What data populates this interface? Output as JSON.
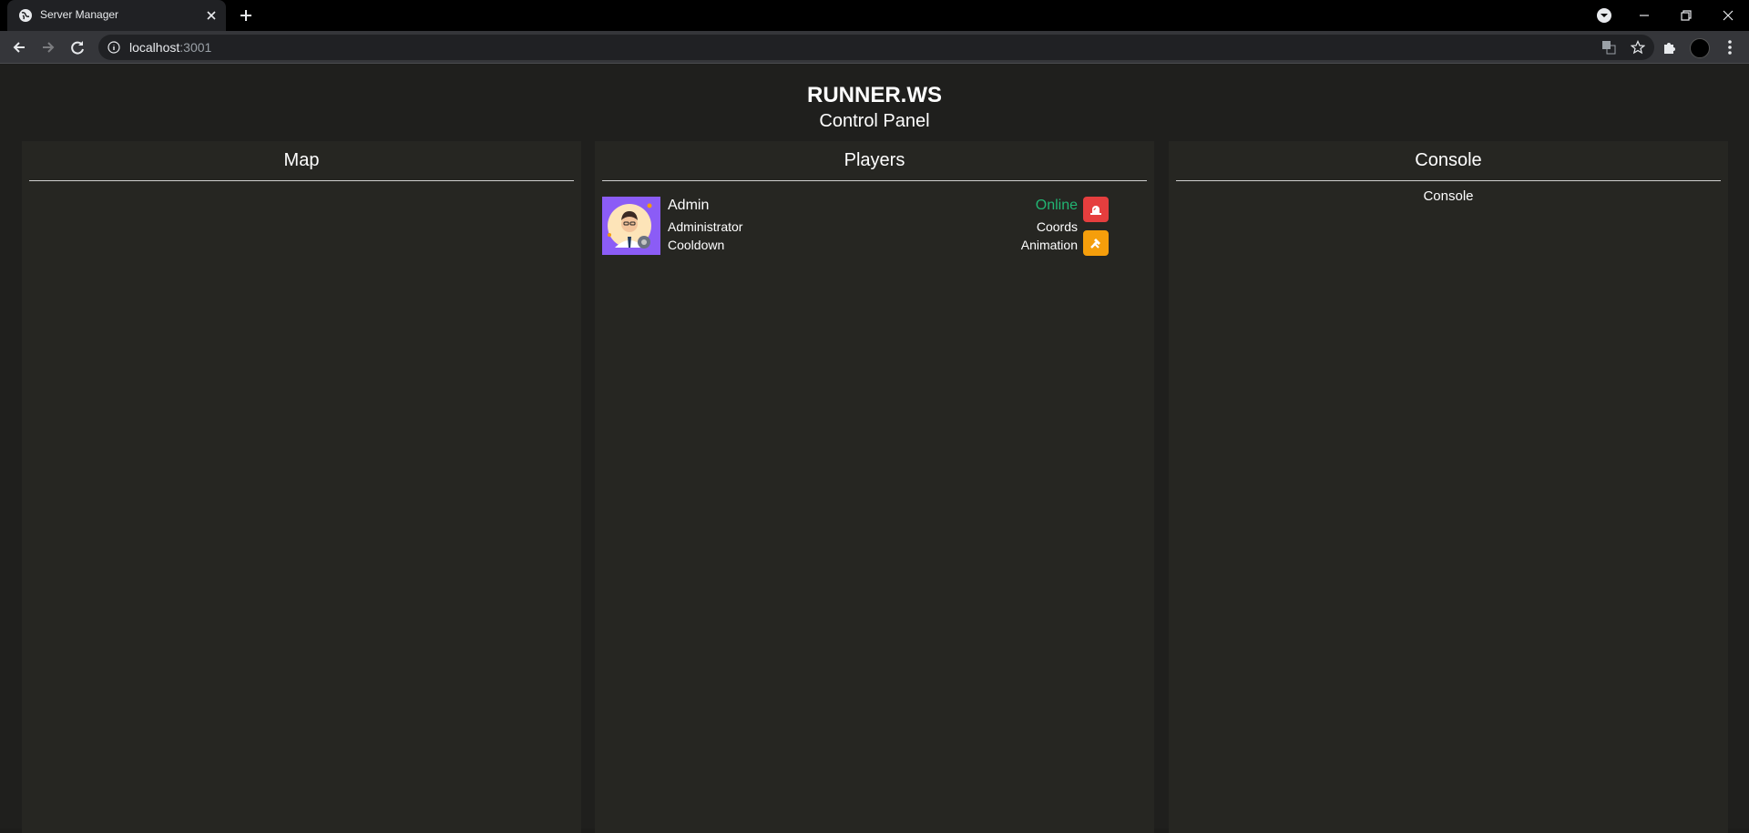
{
  "browser": {
    "tab_title": "Server Manager",
    "url_host": "localhost",
    "url_port": ":3001"
  },
  "header": {
    "brand": "RUNNER.WS",
    "subtitle": "Control Panel"
  },
  "panels": {
    "map": {
      "title": "Map"
    },
    "players": {
      "title": "Players",
      "items": [
        {
          "name": "Admin",
          "role": "Administrator",
          "cooldown_label": "Cooldown",
          "status": "Online",
          "coords_label": "Coords",
          "animation_label": "Animation",
          "avatar_icon": "admin-avatar-icon",
          "actions": [
            {
              "icon": "siren-icon",
              "color": "#e53e3e"
            },
            {
              "icon": "tools-icon",
              "color": "#f59e0b"
            }
          ]
        }
      ]
    },
    "console": {
      "title": "Console",
      "body": "Console"
    }
  },
  "colors": {
    "background": "#1f1f1d",
    "panel": "#262622",
    "online": "#22b573",
    "avatar_bg": "#8b5cf6"
  }
}
